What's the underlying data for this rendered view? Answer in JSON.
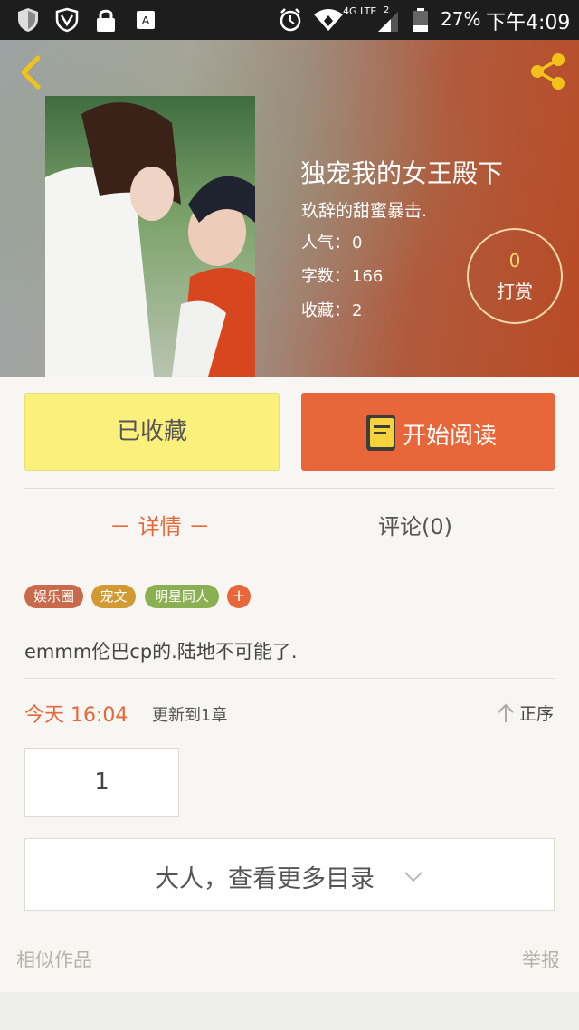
{
  "status_bar": {
    "network_label": "4G LTE",
    "sim_slot": "2",
    "battery": "27%",
    "time": "下午4:09",
    "icons": [
      "shield-icon",
      "vpn-shield-icon",
      "lock-icon",
      "keyboard-icon",
      "alarm-icon",
      "wifi-icon",
      "signal-icon",
      "battery-icon"
    ]
  },
  "header": {
    "back_icon": "chevron-left-icon",
    "share_icon": "share-icon"
  },
  "book": {
    "title": "独宠我的女王殿下",
    "author": "玖辞的甜蜜暴击.",
    "popularity_label": "人气：",
    "popularity_value": "0",
    "word_count_label": "字数：",
    "word_count_value": "166",
    "favorites_label": "收藏：",
    "favorites_value": "2"
  },
  "reward": {
    "count": "0",
    "label": "打赏"
  },
  "actions": {
    "favorited_label": "已收藏",
    "read_label": "开始阅读"
  },
  "tabs": {
    "detail": "－ 详情 －",
    "comments": "评论(0)"
  },
  "tags": [
    {
      "label": "娱乐圈",
      "color": "#c96a4a"
    },
    {
      "label": "宠文",
      "color": "#d19a33"
    },
    {
      "label": "明星同人",
      "color": "#8bb051"
    }
  ],
  "tag_add_label": "+",
  "description": "emmm伦巴cp的.陆地不可能了.",
  "update": {
    "date": "今天 16:04",
    "text": "更新到1章"
  },
  "sort": {
    "label": "正序",
    "icon": "arrow-up-icon"
  },
  "chapter_number": "1",
  "more_catalog": "大人，查看更多目录",
  "footer": {
    "similar": "相似作品",
    "report": "举报"
  },
  "colors": {
    "accent": "#e8673a",
    "favorite_button": "#fbf07b",
    "reward_count": "#f7d86a"
  }
}
